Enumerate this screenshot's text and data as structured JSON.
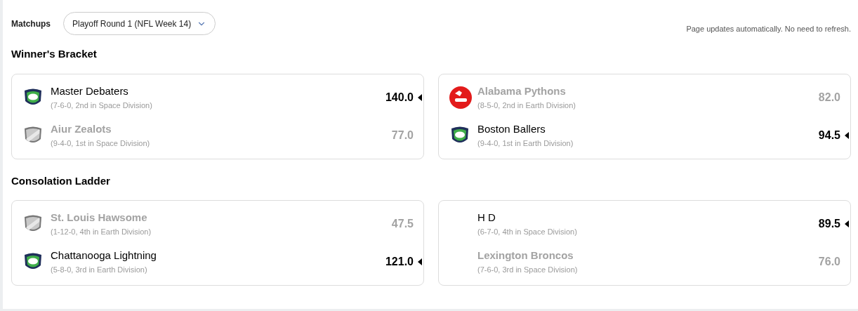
{
  "header": {
    "label": "Matchups",
    "week_select": {
      "value": "Playoff Round 1 (NFL Week 14)"
    },
    "notice": "Page updates automatically. No need to refresh."
  },
  "sections": [
    {
      "title": "Winner's Bracket",
      "matchups": [
        {
          "teams": [
            {
              "name": "Master Debaters",
              "record": "(7-6-0, 2nd in Space Division)",
              "score": "140.0",
              "winner": true,
              "kind": "green"
            },
            {
              "name": "Aiur Zealots",
              "record": "(9-4-0, 1st in Space Division)",
              "score": "77.0",
              "winner": false,
              "kind": "gray"
            }
          ]
        },
        {
          "teams": [
            {
              "name": "Alabama Pythons",
              "record": "(8-5-0, 2nd in Earth Division)",
              "score": "82.0",
              "winner": false,
              "kind": "red"
            },
            {
              "name": "Boston Ballers",
              "record": "(9-4-0, 1st in Earth Division)",
              "score": "94.5",
              "winner": true,
              "kind": "green"
            }
          ]
        }
      ]
    },
    {
      "title": "Consolation Ladder",
      "matchups": [
        {
          "teams": [
            {
              "name": "St. Louis Hawsome",
              "record": "(1-12-0, 4th in Earth Division)",
              "score": "47.5",
              "winner": false,
              "kind": "gray"
            },
            {
              "name": "Chattanooga Lightning",
              "record": "(5-8-0, 3rd in Earth Division)",
              "score": "121.0",
              "winner": true,
              "kind": "green"
            }
          ]
        },
        {
          "teams": [
            {
              "name": "H D",
              "record": "(6-7-0, 4th in Space Division)",
              "score": "89.5",
              "winner": true,
              "kind": "plain"
            },
            {
              "name": "Lexington Broncos",
              "record": "(7-6-0, 3rd in Space Division)",
              "score": "76.0",
              "winner": false,
              "kind": "plain"
            }
          ]
        }
      ]
    }
  ]
}
